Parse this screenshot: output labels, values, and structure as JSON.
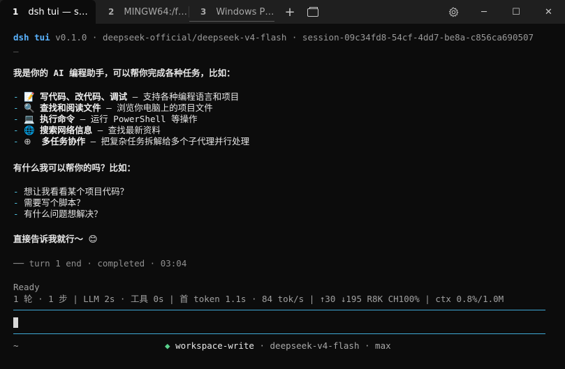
{
  "tabs": [
    {
      "num": "1",
      "label": "dsh tui — s…",
      "active": true
    },
    {
      "num": "2",
      "label": "MINGW64:/f…",
      "active": false
    },
    {
      "num": "3",
      "label": "Windows P…",
      "active": false
    }
  ],
  "window_controls": {
    "new_tab": "+",
    "minimize": "─",
    "maximize": "☐",
    "close": "✕"
  },
  "header": {
    "app": "dsh tui",
    "rest": " v0.1.0 · deepseek-official/deepseek-v4-flash · session-09c34fd8-54cf-4dd7-be8a-c856ca690507",
    "underscore": "_"
  },
  "intro": "我是你的 AI 编程助手，可以帮你完成各种任务，比如：",
  "capabilities": [
    {
      "bullet": "-",
      "icon": "📝",
      "title": "写代码、改代码、调试",
      "desc": " — 支持各种编程语言和项目"
    },
    {
      "bullet": "-",
      "icon": "🔍",
      "title": "查找和阅读文件",
      "desc": " — 浏览你电脑上的项目文件"
    },
    {
      "bullet": "-",
      "icon": "💻",
      "title": "执行命令",
      "desc": " — 运行 PowerShell 等操作"
    },
    {
      "bullet": "-",
      "icon": "🌐",
      "title": "搜索网络信息",
      "desc": " — 查找最新资料"
    },
    {
      "bullet": "-",
      "icon": "⊕",
      "title": " 多任务协作",
      "desc": " — 把复杂任务拆解给多个子代理并行处理"
    }
  ],
  "question": "有什么我可以帮你的吗？比如：",
  "suggestions": [
    {
      "bullet": "-",
      "text": "想让我看看某个项目代码？"
    },
    {
      "bullet": "-",
      "text": "需要写个脚本？"
    },
    {
      "bullet": "-",
      "text": "有什么问题想解决？"
    }
  ],
  "closing": {
    "text": "直接告诉我就行～ ",
    "emoji": "😊"
  },
  "turn_line": "── turn 1 end · completed · 03:04",
  "ready": "Ready",
  "stats": "1 轮 · 1 步 | LLM 2s · 工具 0s | 首 token 1.1s · 84 tok/s | ↑30 ↓195 R8K CH100% | ctx 0.8%/1.0M",
  "input": {
    "value": ""
  },
  "statusbar": {
    "cwd": "~",
    "diamond": "◆",
    "mode": "workspace-write",
    "rest": " · deepseek-v4-flash · max"
  },
  "colors": {
    "accent": "#3fa9d6",
    "app_name": "#5ab3ff",
    "bullet": "#4ec2e0",
    "mode_diamond": "#59d18c"
  }
}
